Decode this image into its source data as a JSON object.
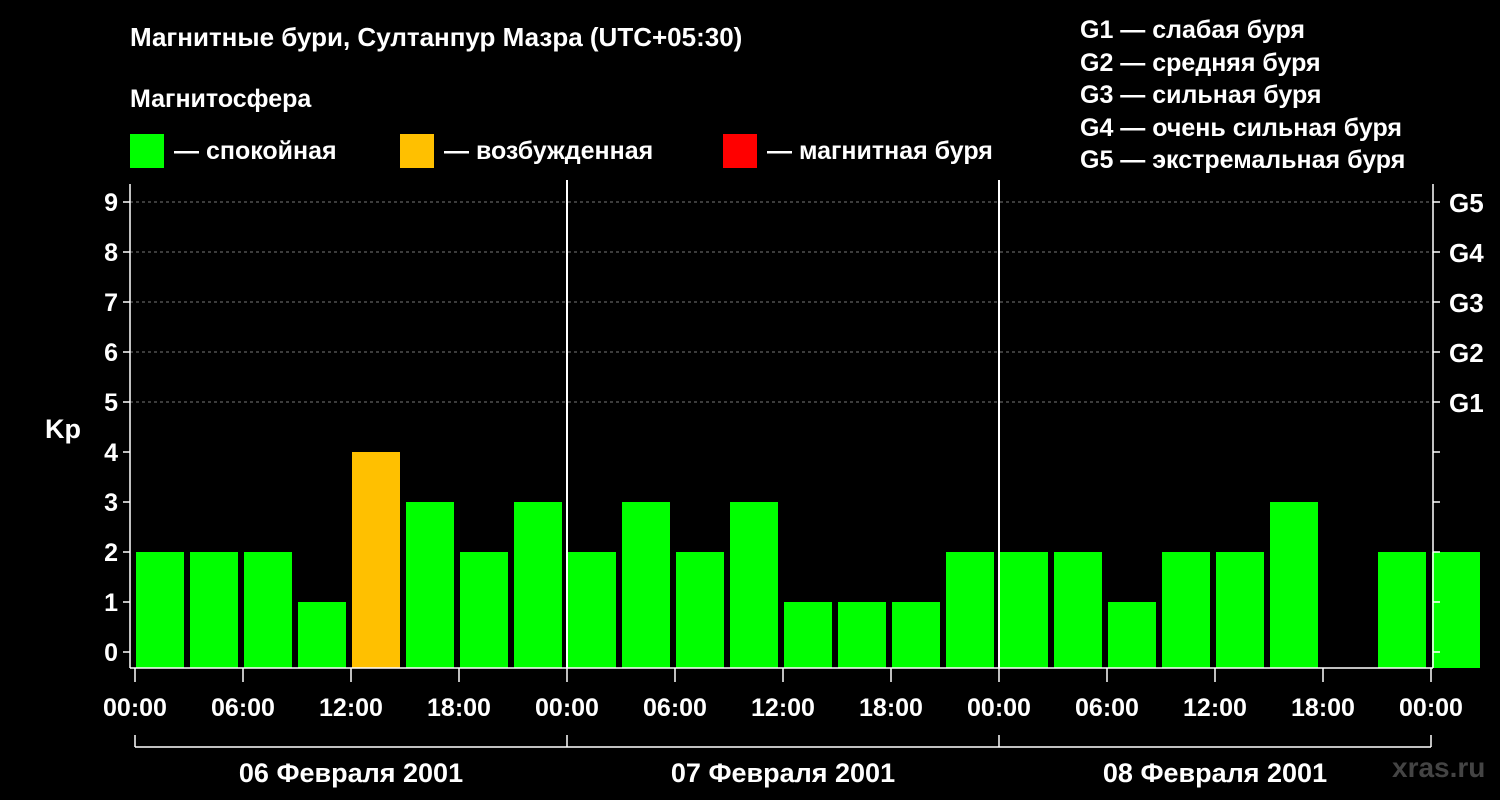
{
  "chart_data": {
    "type": "bar",
    "title": "Магнитные бури, Султанпур Мазра (UTC+05:30)",
    "subtitle": "Магнитосфера",
    "ylabel": "Kp",
    "ylim": [
      0,
      9
    ],
    "y_ticks": [
      "0",
      "1",
      "2",
      "3",
      "4",
      "5",
      "6",
      "7",
      "8",
      "9"
    ],
    "right_ticks": [
      {
        "kp": 5,
        "label": "G1"
      },
      {
        "kp": 6,
        "label": "G2"
      },
      {
        "kp": 7,
        "label": "G3"
      },
      {
        "kp": 8,
        "label": "G4"
      },
      {
        "kp": 9,
        "label": "G5"
      }
    ],
    "x_ticks": [
      "00:00",
      "06:00",
      "12:00",
      "18:00",
      "00:00",
      "06:00",
      "12:00",
      "18:00",
      "00:00",
      "06:00",
      "12:00",
      "18:00",
      "00:00"
    ],
    "days": [
      "06 Февраля 2001",
      "07 Февраля 2001",
      "08 Февраля 2001"
    ],
    "hours_per_bar": 3,
    "values": [
      2,
      2,
      2,
      1,
      4,
      3,
      2,
      3,
      2,
      3,
      2,
      3,
      1,
      1,
      1,
      2,
      2,
      2,
      1,
      2,
      2,
      3,
      null,
      2,
      2
    ],
    "legend": [
      {
        "label": "— спокойная",
        "color": "#00ff00"
      },
      {
        "label": "— возбужденная",
        "color": "#ffc000"
      },
      {
        "label": "— магнитная буря",
        "color": "#ff0000"
      }
    ],
    "storm_levels": [
      "G1 — слабая буря",
      "G2 — средняя буря",
      "G3 — сильная буря",
      "G4 — очень сильная буря",
      "G5 — экстремальная буря"
    ],
    "grid": true
  },
  "credit": "xras.ru"
}
